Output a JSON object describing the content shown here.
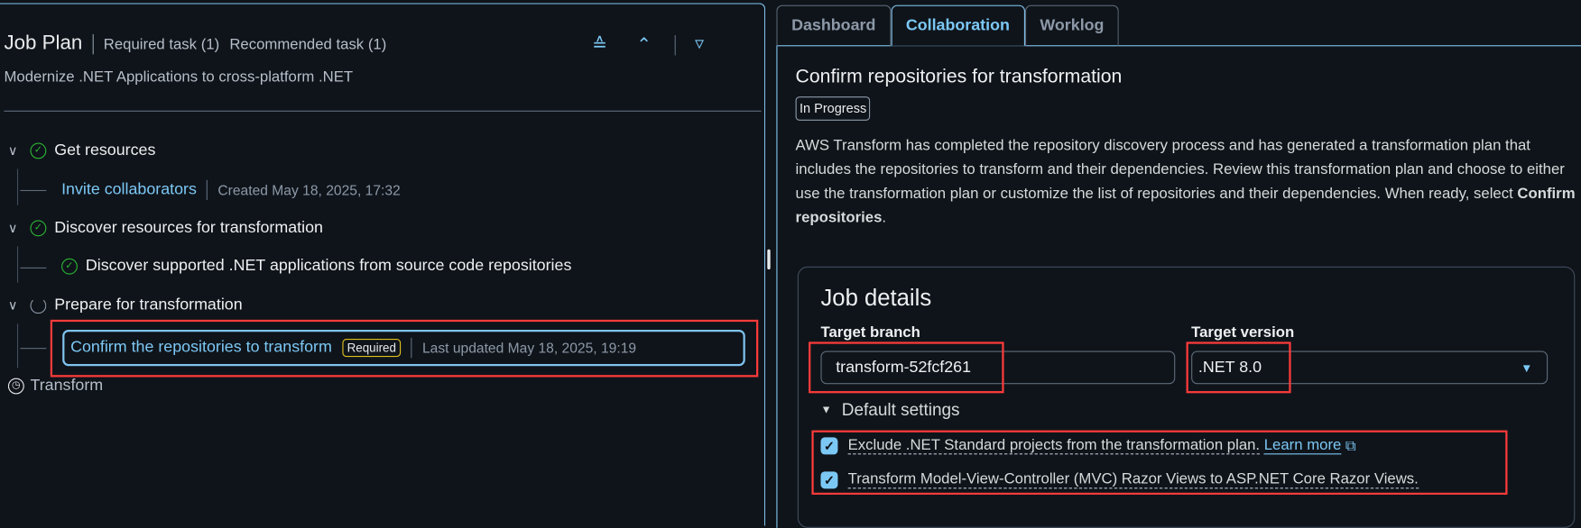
{
  "job_plan": {
    "title": "Job Plan",
    "required_count": "Required task (1)",
    "recommended_count": "Recommended task (1)",
    "subtitle": "Modernize .NET Applications to cross-platform .NET",
    "icons": {
      "expand_all": "double-chevron-down-icon",
      "collapse_all": "double-chevron-up-icon",
      "filter": "filter-icon"
    },
    "steps": [
      {
        "label": "Get resources",
        "status": "completed",
        "children": [
          {
            "label": "Invite collaborators",
            "meta": "Created May 18, 2025, 17:32"
          }
        ]
      },
      {
        "label": "Discover resources for transformation",
        "status": "completed",
        "children": [
          {
            "label": "Discover supported .NET applications from source code repositories",
            "status": "completed"
          }
        ]
      },
      {
        "label": "Prepare for transformation",
        "status": "in-progress",
        "children": [
          {
            "label": "Confirm the repositories to transform",
            "badge": "Required",
            "meta": "Last updated May 18, 2025, 19:19"
          }
        ]
      },
      {
        "label": "Transform",
        "status": "pending"
      }
    ]
  },
  "tabs": [
    {
      "label": "Dashboard"
    },
    {
      "label": "Collaboration",
      "active": true
    },
    {
      "label": "Worklog"
    }
  ],
  "detail": {
    "title": "Confirm repositories for transformation",
    "status": "In Progress",
    "description": "AWS Transform has completed the repository discovery process and has generated a transformation plan that includes the repositories to transform and their dependencies. Review this transformation plan and choose to either use the transformation plan or customize the list of repositories and their dependencies. When ready, select ",
    "description_bold": "Confirm repositories",
    "description_end": ".",
    "job_details": {
      "title": "Job details",
      "target_branch_label": "Target branch",
      "target_branch_value": "transform-52fcf261",
      "target_version_label": "Target version",
      "target_version_value": ".NET 8.0",
      "default_settings_label": "Default settings",
      "options": [
        {
          "label": "Exclude .NET Standard projects from the transformation plan.",
          "checked": true,
          "link": "Learn more"
        },
        {
          "label": "Transform Model-View-Controller (MVC) Razor Views to ASP.NET Core Razor Views.",
          "checked": true
        }
      ]
    }
  },
  "colors": {
    "background": "#0f141a",
    "accent": "#7cc8f5",
    "success": "#2bb534",
    "highlight": "#ff3b3b",
    "badge_required": "#e0c01f"
  }
}
